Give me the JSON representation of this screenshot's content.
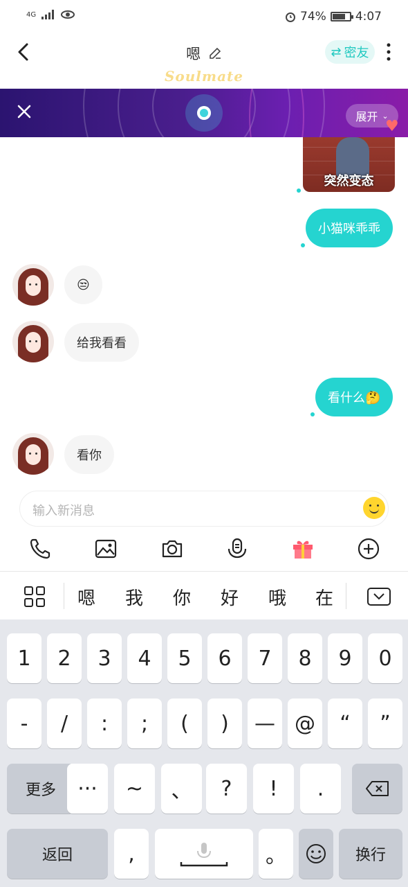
{
  "statusbar": {
    "network": "4G",
    "battery_pct": "74%",
    "time": "4:07",
    "battery_level": 0.74
  },
  "header": {
    "title": "嗯",
    "close_friend_label": "密友",
    "brand": "Soulmate"
  },
  "banner": {
    "expand_label": "展开"
  },
  "sticker": {
    "caption": "突然变态"
  },
  "messages": [
    {
      "side": "out",
      "text": "小猫咪乖乖"
    },
    {
      "side": "in",
      "text": "😒"
    },
    {
      "side": "in",
      "text": "给我看看"
    },
    {
      "side": "out",
      "text": "看什么🤔"
    },
    {
      "side": "in",
      "text": "看你"
    }
  ],
  "composer": {
    "placeholder": "输入新消息"
  },
  "toolbar": {
    "icons": [
      "phone-icon",
      "image-icon",
      "camera-icon",
      "voice-icon",
      "gift-icon",
      "plus-icon"
    ]
  },
  "suggestions": [
    "嗯",
    "我",
    "你",
    "好",
    "哦",
    "在"
  ],
  "keyboard": {
    "row1": [
      "1",
      "2",
      "3",
      "4",
      "5",
      "6",
      "7",
      "8",
      "9",
      "0"
    ],
    "row2": [
      "-",
      "/",
      ":",
      ";",
      "(",
      ")",
      "—",
      "@",
      "“",
      "”"
    ],
    "row3": [
      "更多",
      "···",
      "~",
      "、",
      "?",
      "!",
      "."
    ],
    "row4": [
      "返回",
      ",",
      "。",
      "换行"
    ]
  }
}
